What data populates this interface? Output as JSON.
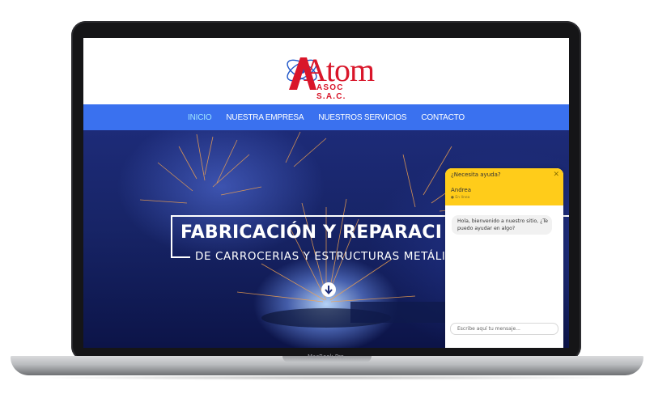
{
  "device": {
    "label": "MacBook Pro"
  },
  "logo": {
    "word": "Atom",
    "subtitle": "ASOC S.A.C."
  },
  "nav": {
    "items": [
      {
        "label": "INICIO",
        "active": true
      },
      {
        "label": "NUESTRA EMPRESA",
        "active": false
      },
      {
        "label": "NUESTROS SERVICIOS",
        "active": false
      },
      {
        "label": "CONTACTO",
        "active": false
      }
    ]
  },
  "hero": {
    "title": "FABRICACIÓN Y REPARACI",
    "subtitle": "DE CARROCERIAS Y ESTRUCTURAS METÁLIC"
  },
  "chat": {
    "title": "¿Necesita ayuda?",
    "close": "✕",
    "agent_name": "Andrea",
    "agent_status": "● En línea",
    "message": "Hola, bienvenido a nuestro sitio, ¿Te puedo ayudar en algo?",
    "input_placeholder": "Escribe aquí tu mensaje..."
  },
  "colors": {
    "nav_bg": "#3a71ef",
    "nav_active": "#9fe6ff",
    "logo_red": "#d9162a",
    "chat_yellow": "#ffcc1a",
    "hero_blue": "#1d2b78"
  }
}
